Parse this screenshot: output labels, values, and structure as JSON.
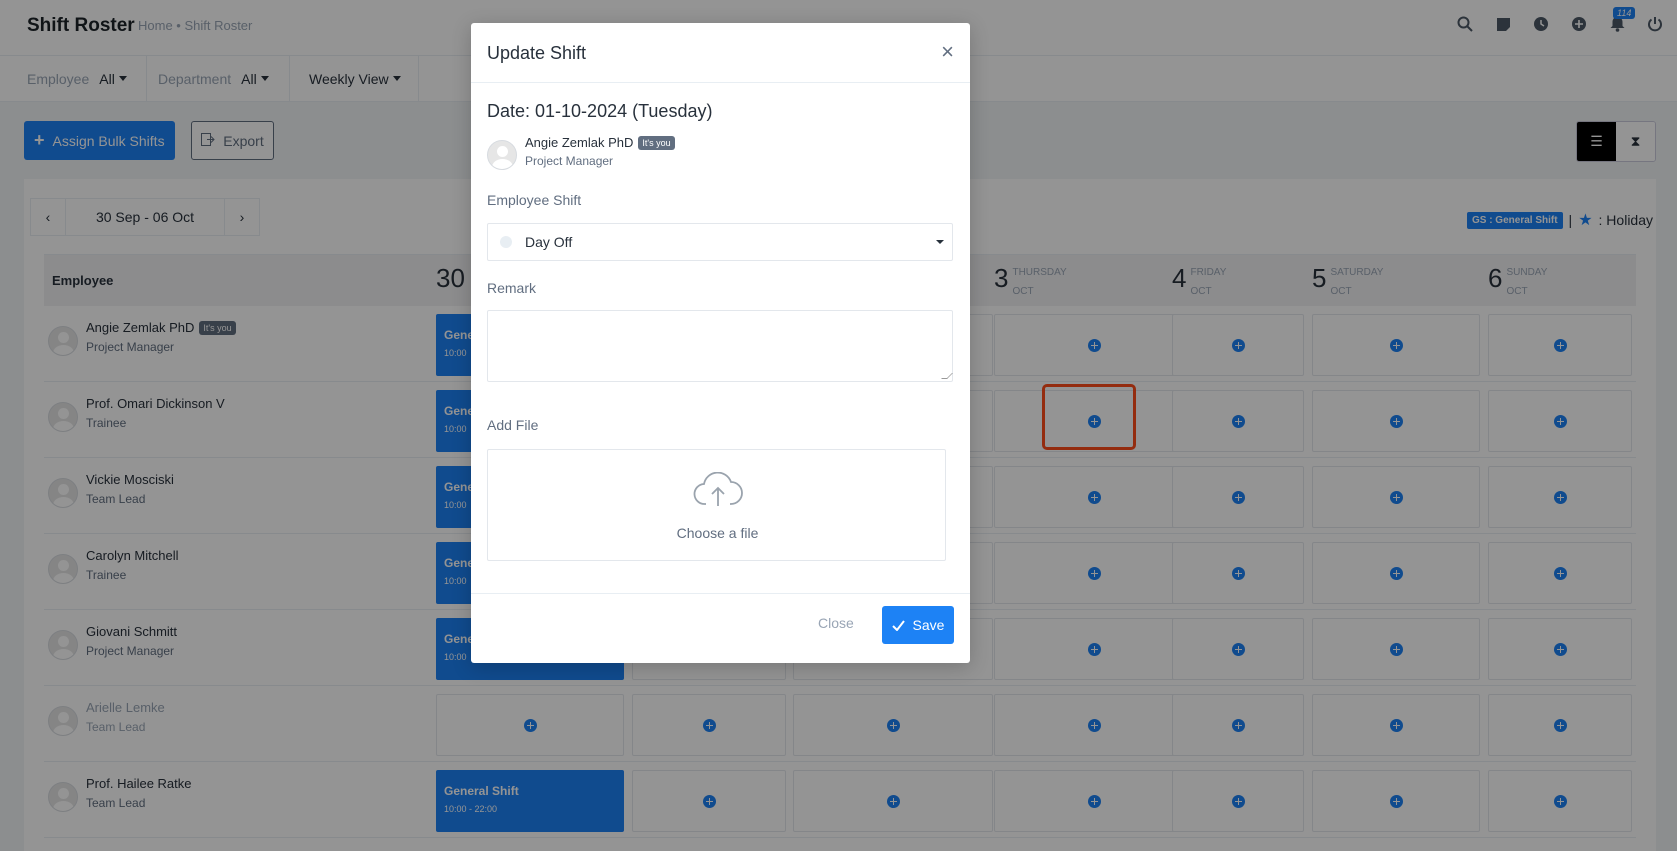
{
  "header": {
    "title": "Shift Roster",
    "breadcrumb": "Home • Shift Roster",
    "notification_count": "114"
  },
  "filters": {
    "employee_label": "Employee",
    "employee_value": "All",
    "department_label": "Department",
    "department_value": "All",
    "view_value": "Weekly View"
  },
  "actions": {
    "assign_bulk": "Assign Bulk Shifts",
    "export": "Export"
  },
  "week": {
    "range": "30 Sep - 06 Oct"
  },
  "legend": {
    "gs": "GS : General Shift",
    "separator": "|",
    "holiday": ": Holiday"
  },
  "table": {
    "employee_header": "Employee",
    "days": [
      {
        "num": "30",
        "weekday": "",
        "month": ""
      },
      {
        "num": "3",
        "weekday": "THURSDAY",
        "month": "OCT"
      },
      {
        "num": "4",
        "weekday": "FRIDAY",
        "month": "OCT"
      },
      {
        "num": "5",
        "weekday": "SATURDAY",
        "month": "OCT"
      },
      {
        "num": "6",
        "weekday": "SUNDAY",
        "month": "OCT"
      }
    ],
    "rows": [
      {
        "name": "Angie Zemlak PhD",
        "role": "Project Manager",
        "badge": "It's you",
        "shift_name": "Gene",
        "shift_time": "10:00"
      },
      {
        "name": "Prof. Omari Dickinson V",
        "role": "Trainee",
        "shift_name": "Gene",
        "shift_time": "10:00"
      },
      {
        "name": "Vickie Mosciski",
        "role": "Team Lead",
        "shift_name": "Gene",
        "shift_time": "10:00"
      },
      {
        "name": "Carolyn Mitchell",
        "role": "Trainee",
        "shift_name": "Gene",
        "shift_time": "10:00"
      },
      {
        "name": "Giovani Schmitt",
        "role": "Project Manager",
        "shift_name": "Gene",
        "shift_time": "10:00"
      },
      {
        "name": "Arielle Lemke",
        "role": "Team Lead"
      },
      {
        "name": "Prof. Hailee Ratke",
        "role": "Team Lead",
        "shift_name": "General Shift",
        "shift_time": "10:00 - 22:00"
      }
    ]
  },
  "modal": {
    "title": "Update Shift",
    "close_symbol": "×",
    "date": "Date: 01-10-2024 (Tuesday)",
    "employee_name": "Angie Zemlak PhD",
    "employee_badge": "It's you",
    "employee_role": "Project Manager",
    "shift_label": "Employee Shift",
    "shift_value": "Day Off",
    "remark_label": "Remark",
    "file_label": "Add File",
    "file_prompt": "Choose a file",
    "close_button": "Close",
    "save_button": "Save"
  },
  "colors": {
    "primary": "#1d82f5",
    "highlight": "#ff4d1a"
  }
}
